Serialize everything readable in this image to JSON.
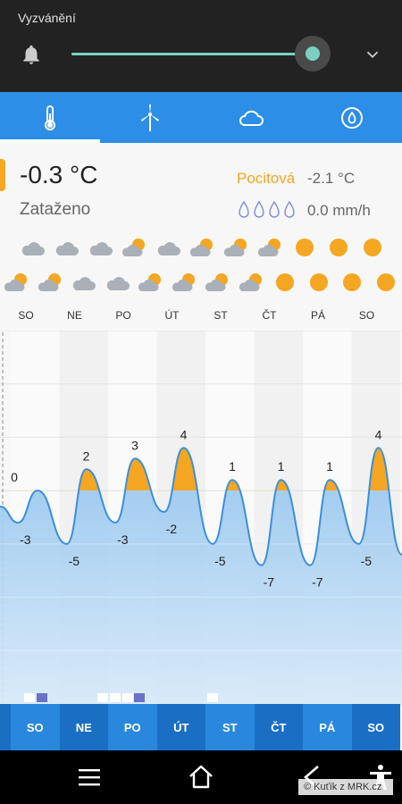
{
  "volume": {
    "title": "Vyzvánění",
    "level": 0.93,
    "bell_icon": "bell-icon",
    "expand_icon": "chevron-down-icon",
    "accent": "#7ad1c2"
  },
  "tabs": [
    {
      "name": "temperature",
      "icon": "thermometer-icon",
      "active": true
    },
    {
      "name": "wind",
      "icon": "wind-turbine-icon",
      "active": false
    },
    {
      "name": "clouds",
      "icon": "cloud-icon",
      "active": false
    },
    {
      "name": "precipitation",
      "icon": "drop-circle-icon",
      "active": false
    }
  ],
  "current": {
    "temperature": "-0.3 °C",
    "condition": "Zataženo",
    "feels_label": "Pocitová",
    "feels_value": "-2.1 °C",
    "precipitation": "0.0 mm/h"
  },
  "forecast_icons": {
    "row1": [
      "cloud",
      "cloud",
      "cloud",
      "sun-cloud",
      "cloud",
      "sun-cloud",
      "sun-cloud",
      "sun-cloud",
      "sun",
      "sun",
      "sun"
    ],
    "row2": [
      "sun-cloud",
      "sun-cloud",
      "cloud",
      "cloud",
      "sun-cloud",
      "sun-cloud",
      "sun-cloud",
      "sun-cloud",
      "sun",
      "sun",
      "sun",
      "sun"
    ]
  },
  "days": [
    "SO",
    "NE",
    "PO",
    "ÚT",
    "ST",
    "ČT",
    "PÁ",
    "SO"
  ],
  "chart_data": {
    "type": "area",
    "categories": [
      "SO",
      "NE",
      "PO",
      "ÚT",
      "ST",
      "ČT",
      "PÁ",
      "SO"
    ],
    "max_labels": [
      "0",
      "2",
      "3",
      "4",
      "1",
      "1",
      "1",
      "4"
    ],
    "min_labels": [
      "-3",
      "-5",
      "-3",
      "-2",
      "-5",
      "-7",
      "-7",
      "-5"
    ],
    "max_values": [
      0,
      2,
      3,
      4,
      1,
      1,
      1,
      4
    ],
    "min_values": [
      -3,
      -5,
      -3,
      -2,
      -5,
      -7,
      -7,
      -5
    ],
    "ylim": [
      -20,
      15
    ],
    "colors": {
      "positive": "#f5a623",
      "negative": "#7fb8ea",
      "line": "#3b8fdc"
    }
  },
  "nav": {
    "menu_icon": "menu-icon",
    "home_icon": "home-icon",
    "back_icon": "back-icon",
    "accessibility_icon": "accessibility-icon"
  },
  "watermark": "© Kuťík z MRK.cz"
}
